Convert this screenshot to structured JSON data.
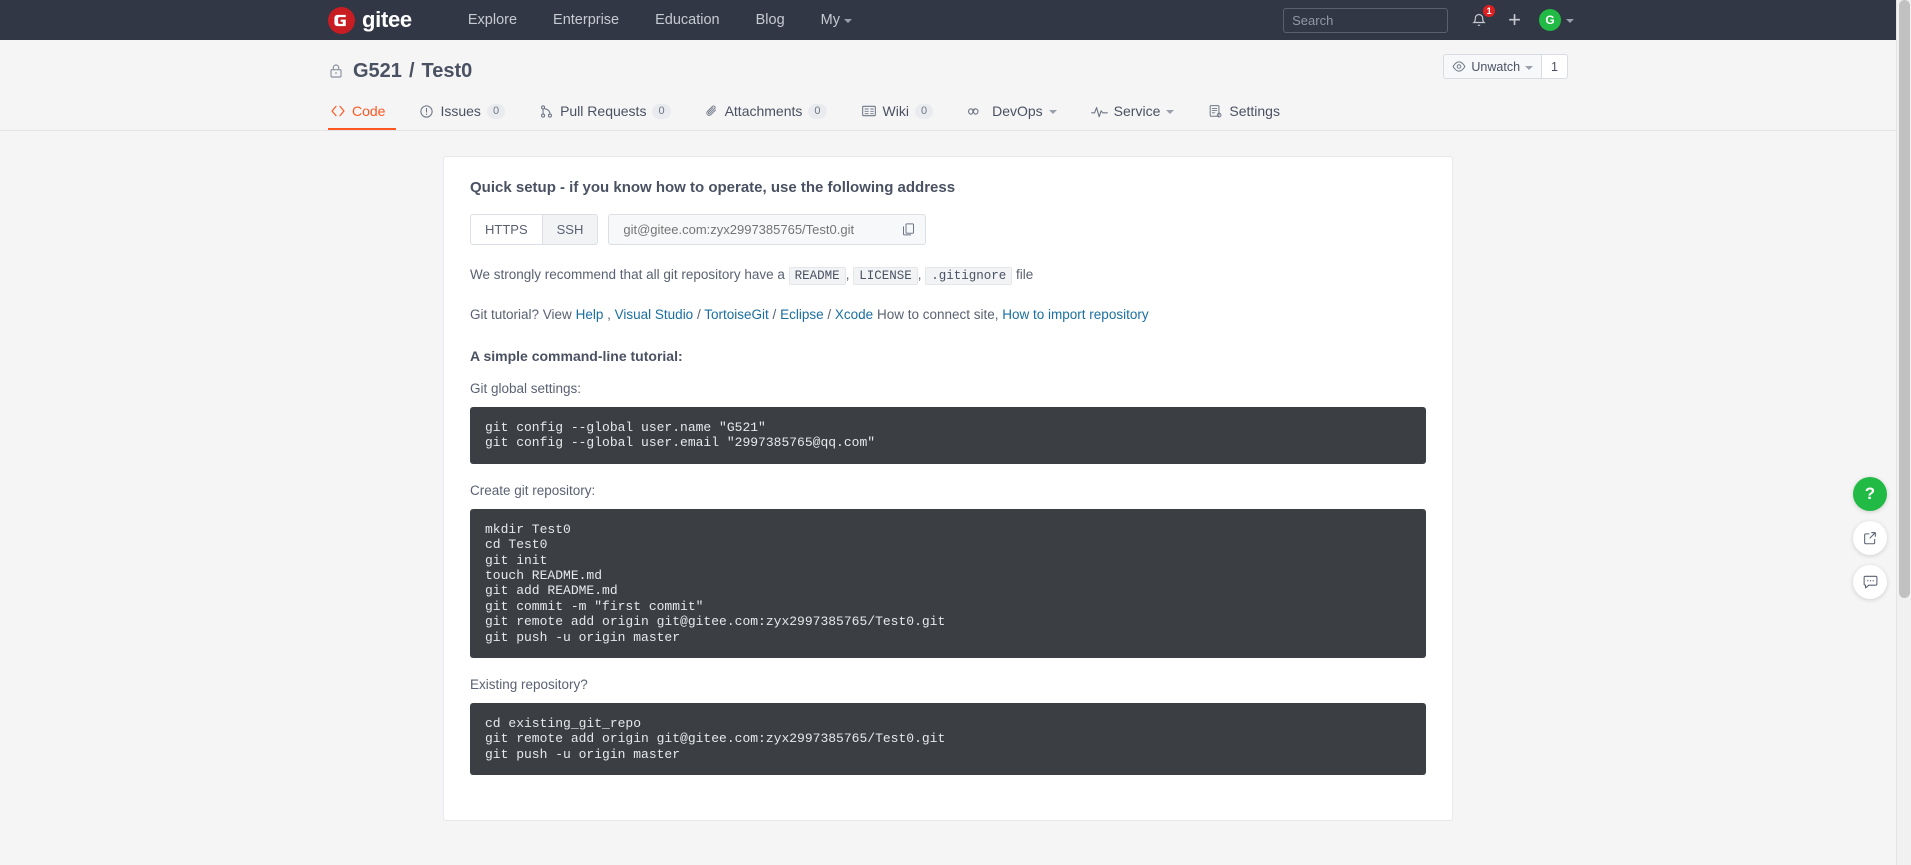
{
  "navbar": {
    "logo_text": "gitee",
    "links": [
      {
        "label": "Explore",
        "has_caret": false
      },
      {
        "label": "Enterprise",
        "has_caret": false
      },
      {
        "label": "Education",
        "has_caret": false
      },
      {
        "label": "Blog",
        "has_caret": false
      },
      {
        "label": "My",
        "has_caret": true
      }
    ],
    "search_placeholder": "Search",
    "search_value": "",
    "notification_count": "1",
    "plus_label": "+",
    "avatar_letter": "G",
    "brand_color": "#c71d23",
    "bar_color": "#313744"
  },
  "repo": {
    "owner": "G521",
    "separator": "/",
    "name": "Test0",
    "visibility_icon": "lock-icon",
    "watch_label": "Unwatch",
    "watch_count": "1",
    "tabs": [
      {
        "label": "Code",
        "count": "",
        "icon": "code-icon",
        "active": true,
        "caret": false
      },
      {
        "label": "Issues",
        "count": "0",
        "icon": "issue-icon",
        "active": false,
        "caret": false
      },
      {
        "label": "Pull Requests",
        "count": "0",
        "icon": "pull-request-icon",
        "active": false,
        "caret": false
      },
      {
        "label": "Attachments",
        "count": "0",
        "icon": "paperclip-icon",
        "active": false,
        "caret": false
      },
      {
        "label": "Wiki",
        "count": "0",
        "icon": "book-icon",
        "active": false,
        "caret": false
      },
      {
        "label": "DevOps",
        "count": "",
        "icon": "infinity-icon",
        "active": false,
        "caret": true
      },
      {
        "label": "Service",
        "count": "",
        "icon": "pulse-icon",
        "active": false,
        "caret": true
      },
      {
        "label": "Settings",
        "count": "",
        "icon": "settings-icon",
        "active": false,
        "caret": false
      }
    ],
    "active_tab_color": "#ff5722"
  },
  "quick_setup": {
    "title": "Quick setup - if you know how to operate, use the following address",
    "protocols": [
      {
        "label": "HTTPS",
        "selected": true
      },
      {
        "label": "SSH",
        "selected": false
      }
    ],
    "clone_url": "git@gitee.com:zyx2997385765/Test0.git",
    "copy_icon": "copy-icon",
    "recommend": {
      "prefix": "We strongly recommend that all git repository have a",
      "file1": "README",
      "comma1": ",",
      "file2": "LICENSE",
      "comma2": ",",
      "file3": ".gitignore",
      "suffix": "file"
    },
    "tutorial": {
      "prefix": "Git tutorial? View",
      "help": "Help",
      "comma": ",",
      "visual_studio": "Visual Studio",
      "sep1": "/",
      "tortoisegit": "TortoiseGit",
      "sep2": "/",
      "eclipse": "Eclipse",
      "sep3": "/",
      "xcode": "Xcode",
      "middle": "How to connect site,",
      "import": "How to import repository"
    }
  },
  "tutorial_section": {
    "heading": "A simple command-line tutorial:",
    "blocks": [
      {
        "label": "Git global settings:",
        "code": "git config --global user.name \"G521\"\ngit config --global user.email \"2997385765@qq.com\""
      },
      {
        "label": "Create git repository:",
        "code": "mkdir Test0\ncd Test0\ngit init\ntouch README.md\ngit add README.md\ngit commit -m \"first commit\"\ngit remote add origin git@gitee.com:zyx2997385765/Test0.git\ngit push -u origin master"
      },
      {
        "label": "Existing repository?",
        "code": "cd existing_git_repo\ngit remote add origin git@gitee.com:zyx2997385765/Test0.git\ngit push -u origin master"
      }
    ]
  },
  "float_buttons": [
    {
      "name": "help-button",
      "glyph": "?",
      "icon": "question-mark-icon",
      "color": "#21ba45"
    },
    {
      "name": "share-button",
      "glyph": "",
      "icon": "external-link-icon",
      "color": "#ffffff"
    },
    {
      "name": "feedback-button",
      "glyph": "",
      "icon": "comment-icon",
      "color": "#ffffff"
    }
  ]
}
